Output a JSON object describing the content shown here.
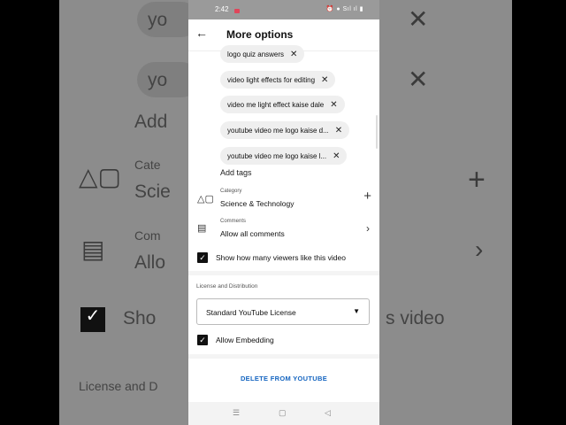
{
  "status_bar": {
    "time": "2:42",
    "system_icons": "⏰ ●  Sıl  ıl  ▮"
  },
  "header": {
    "title": "More options",
    "back_icon": "arrow-back-icon"
  },
  "tags": [
    {
      "label": "logo quiz answers"
    },
    {
      "label": "video light effects for editing"
    },
    {
      "label": "video me light effect kaise dale"
    },
    {
      "label": "youtube video me logo kaise d..."
    },
    {
      "label": "youtube video me logo kaise l..."
    }
  ],
  "add_tags_label": "Add tags",
  "category": {
    "label": "Category",
    "value": "Science & Technology"
  },
  "comments": {
    "label": "Comments",
    "value": "Allow all comments"
  },
  "show_likes": {
    "label": "Show how many viewers like this video",
    "checked": true
  },
  "license": {
    "section_title": "License and Distribution",
    "selected": "Standard YouTube License",
    "allow_embedding_label": "Allow Embedding",
    "allow_embedding_checked": true
  },
  "delete_label": "DELETE FROM YOUTUBE",
  "background": {
    "left_texts": [
      "yo",
      "yo",
      "Add",
      "Cate",
      "Scie",
      "Com",
      "Allo",
      "Sho",
      "License and D"
    ],
    "right_texts": [
      "s video"
    ]
  },
  "colors": {
    "accent": "#1565c0",
    "checkbox": "#111111",
    "chip_bg": "#efefef"
  }
}
